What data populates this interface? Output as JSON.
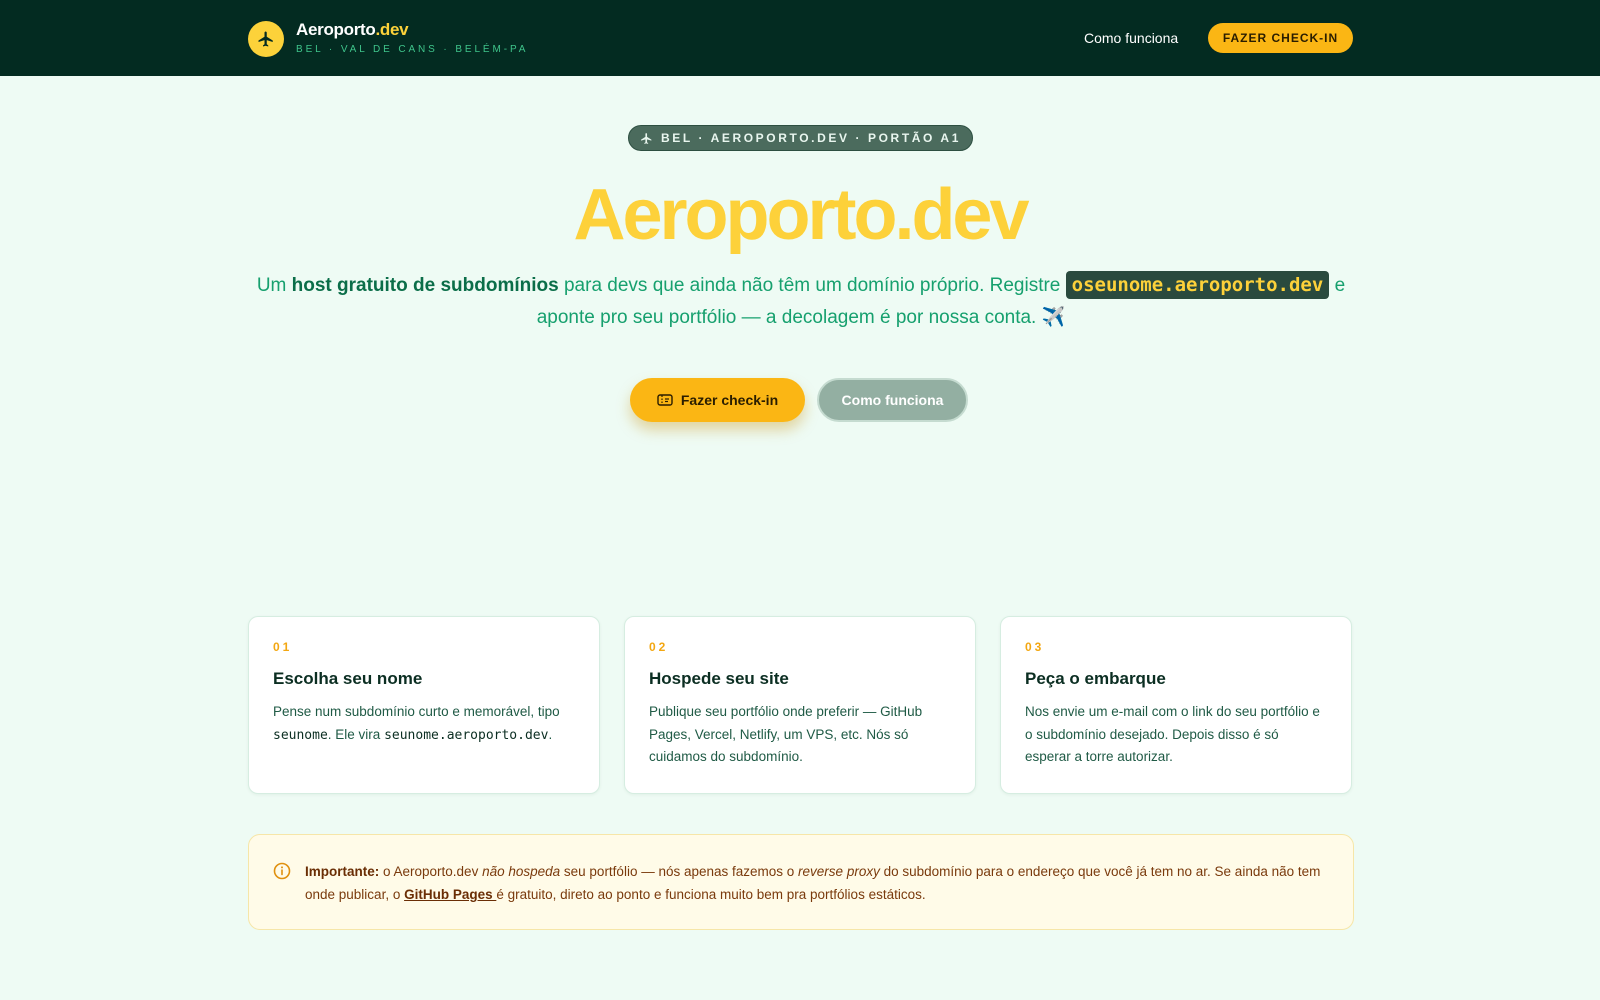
{
  "header": {
    "brand_name": "Aeroporto",
    "brand_tld": ".dev",
    "brand_subtitle": "BEL · VAL DE CANS · BELÉM-PA",
    "nav_link": "Como funciona",
    "cta": "FAZER CHECK-IN"
  },
  "hero": {
    "gate_pill": "BEL · AEROPORTO.DEV · PORTÃO A1",
    "title": "Aeroporto.dev",
    "subtitle_pre": "Um ",
    "subtitle_strong": "host gratuito de subdomínios",
    "subtitle_mid": " para devs que ainda não têm um domínio próprio. Registre ",
    "subtitle_code": "oseunome.aeroporto.dev",
    "subtitle_post": " e aponte pro seu portfólio — a decolagem é por nossa conta. ✈️",
    "primary_button": "Fazer check-in",
    "secondary_button": "Como funciona"
  },
  "steps": [
    {
      "number": "01",
      "title": "Escolha seu nome",
      "body_pre": "Pense num subdomínio curto e memorável, tipo ",
      "code1": "seunome",
      "body_mid": ". Ele vira ",
      "code2": "seunome.aeroporto.dev",
      "body_post": "."
    },
    {
      "number": "02",
      "title": "Hospede seu site",
      "body": "Publique seu portfólio onde preferir — GitHub Pages, Vercel, Netlify, um VPS, etc. Nós só cuidamos do subdomínio."
    },
    {
      "number": "03",
      "title": "Peça o embarque",
      "body": "Nos envie um e-mail com o link do seu portfólio e o subdomínio desejado. Depois disso é só esperar a torre autorizar."
    }
  ],
  "notice": {
    "label": "Importante:",
    "text1": " o Aeroporto.dev ",
    "em1": "não hospeda",
    "text2": " seu portfólio — nós apenas fazemos o ",
    "em2": "reverse proxy",
    "text3": " do subdomínio para o endereço que você já tem no ar. Se ainda não tem onde publicar, o ",
    "link": "GitHub Pages ",
    "text4": " é gratuito, direto ao ponto e funciona muito bem pra portfólios estáticos."
  },
  "colors": {
    "header_bg": "#032b21",
    "page_bg": "#eefbf4",
    "accent_yellow": "#fdd13a",
    "cta_amber": "#fbb614",
    "text_green": "#16a06e"
  }
}
